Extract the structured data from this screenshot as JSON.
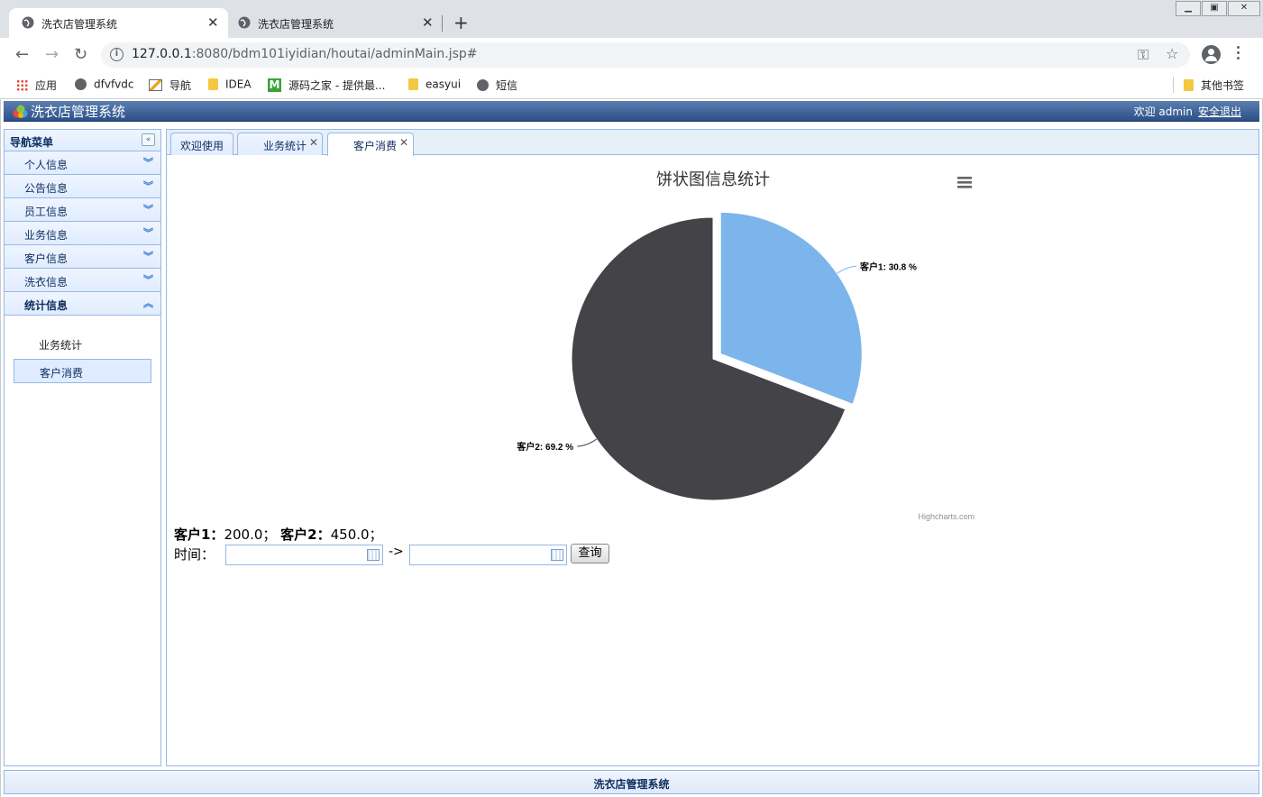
{
  "browser": {
    "tabs": [
      {
        "title": "洗衣店管理系统",
        "active": true
      },
      {
        "title": "洗衣店管理系统",
        "active": false
      }
    ],
    "url_host": "127.0.0.1",
    "url_rest": ":8080/bdm101iyidian/houtai/adminMain.jsp#",
    "bookmarks": [
      {
        "label": "应用",
        "icon": "apps-grid-icon"
      },
      {
        "label": "dfvfvdc",
        "icon": "globe-icon"
      },
      {
        "label": "导航",
        "icon": "image-icon"
      },
      {
        "label": "IDEA",
        "icon": "folder-icon"
      },
      {
        "label": "源码之家 - 提供最...",
        "icon": "m-logo-icon"
      },
      {
        "label": "easyui",
        "icon": "folder-icon"
      },
      {
        "label": "短信",
        "icon": "globe-icon"
      }
    ],
    "other_bookmarks": "其他书签"
  },
  "app": {
    "title": "洗衣店管理系统",
    "welcome": "欢迎 admin",
    "logout": "安全退出",
    "footer": "洗衣店管理系统"
  },
  "nav": {
    "title": "导航菜单",
    "sections": [
      {
        "label": "个人信息",
        "open": false
      },
      {
        "label": "公告信息",
        "open": false
      },
      {
        "label": "员工信息",
        "open": false
      },
      {
        "label": "业务信息",
        "open": false
      },
      {
        "label": "客户信息",
        "open": false
      },
      {
        "label": "洗衣信息",
        "open": false
      },
      {
        "label": "统计信息",
        "open": true
      }
    ],
    "sub_items": [
      {
        "label": "业务统计",
        "selected": false
      },
      {
        "label": "客户消费",
        "selected": true
      }
    ]
  },
  "content_tabs": [
    {
      "label": "欢迎使用",
      "closable": false,
      "active": false
    },
    {
      "label": "业务统计",
      "closable": true,
      "active": false
    },
    {
      "label": "客户消费",
      "closable": true,
      "active": true
    }
  ],
  "chart_data": {
    "type": "pie",
    "title": "饼状图信息统计",
    "credits": "Highcharts.com",
    "slices": [
      {
        "name": "客户1",
        "percent": 30.8,
        "label": "客户1: 30.8 %",
        "color": "#7cb5ec",
        "sliced": true
      },
      {
        "name": "客户2",
        "percent": 69.2,
        "label": "客户2: 69.2 %",
        "color": "#434348",
        "sliced": false
      }
    ]
  },
  "totals": {
    "c1_label": "客户1：",
    "c1_value": "200.0；",
    "c2_label": "客户2：",
    "c2_value": "450.0；"
  },
  "query": {
    "time_label": "时间：",
    "arrow": "->",
    "start_value": "",
    "end_value": "",
    "button": "查询"
  },
  "colors": {
    "header_start": "#5b7fb1",
    "header_end": "#2c5087",
    "panel_border": "#95b8e7",
    "panel_bg": "#e0ecff"
  }
}
